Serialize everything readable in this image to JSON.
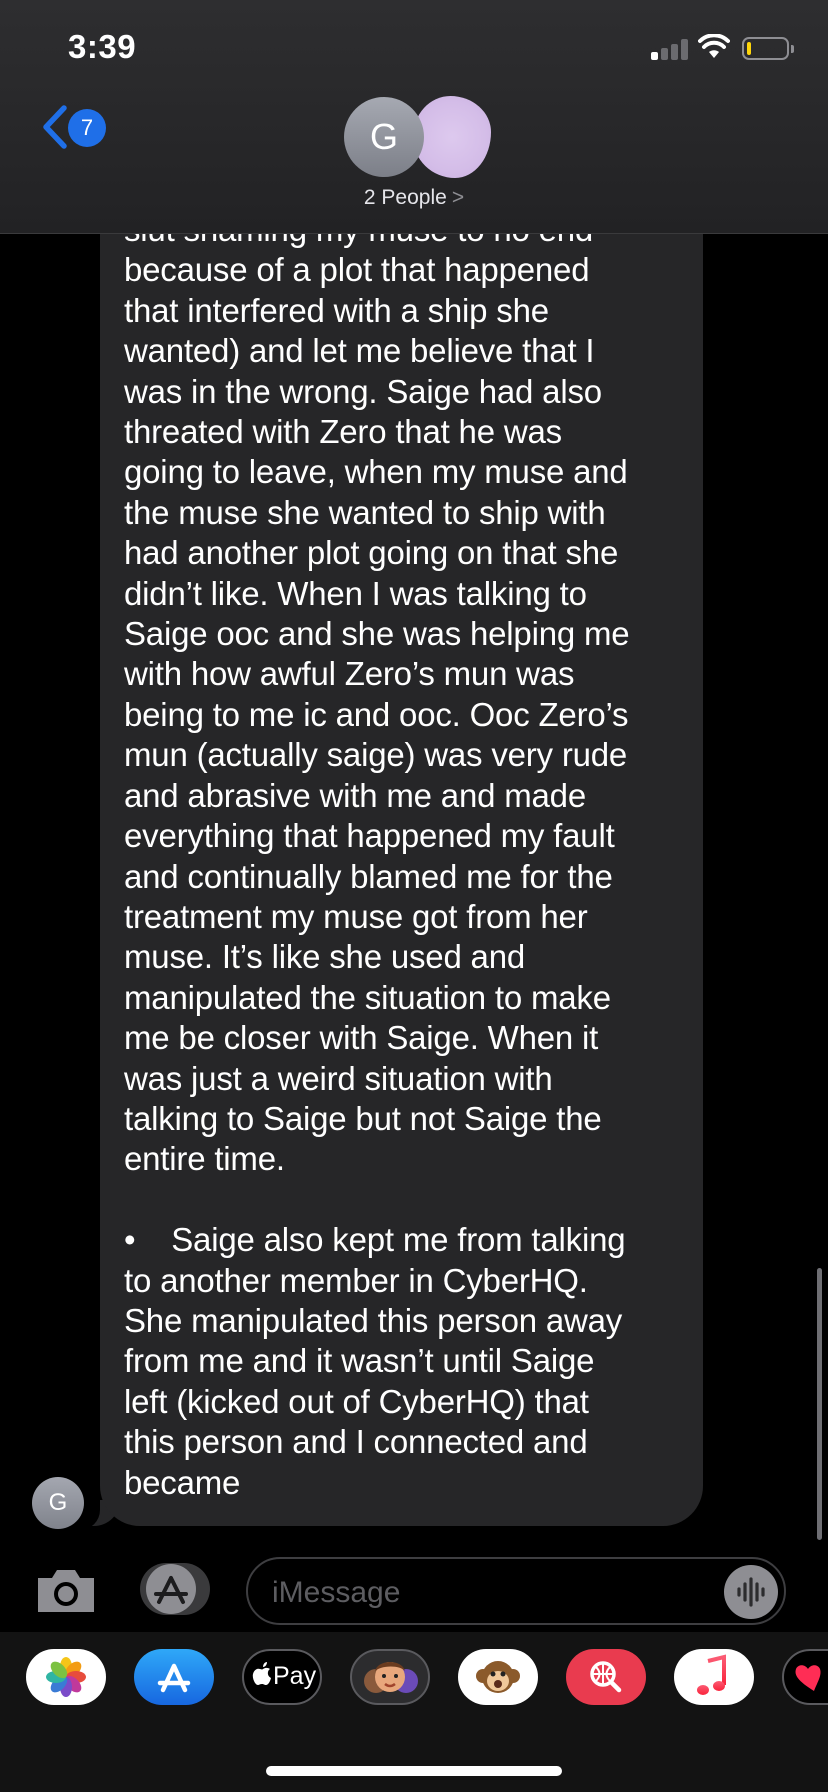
{
  "status_bar": {
    "time": "3:39"
  },
  "header": {
    "back_badge_count": "7",
    "avatar_initial": "G",
    "participants_label": "2 People",
    "participants_chevron": ">"
  },
  "message": {
    "sender_initial": "G",
    "text": "slut shaming my muse to no end\nbecause of a plot that happened\nthat interfered with a ship she\nwanted) and let me believe that I\nwas in the wrong. Saige had also\nthreated with Zero that he was\ngoing to leave, when my muse and\nthe muse she wanted to ship with\nhad another plot going on that she\ndidn’t like. When I was talking to\nSaige ooc and she was helping me\nwith how awful Zero’s mun was\nbeing to me ic and ooc. Ooc Zero’s\nmun (actually saige) was very rude\nand abrasive with me and made\neverything that happened my fault\nand continually blamed me for the\ntreatment my muse got from her\nmuse. It’s like she used and\nmanipulated the situation to make\nme be closer with Saige. When it\nwas just a weird situation with\ntalking to Saige but not Saige the\nentire time.\n\n•    Saige also kept me from talking\nto another member in CyberHQ.\nShe manipulated this person away\nfrom me and it wasn’t until Saige\nleft (kicked out of CyberHQ) that\nthis person and I connected and\nbecame"
  },
  "composer": {
    "placeholder": "iMessage"
  },
  "app_drawer": {
    "apple_pay_label": "Pay",
    "apps": [
      "photos-icon",
      "app-store-icon",
      "apple-pay-icon",
      "memoji-icon",
      "animoji-icon",
      "web-images-search-icon",
      "music-icon",
      "digital-touch-icon"
    ]
  },
  "colors": {
    "accent": "#1f6fe8",
    "bubble": "#262628",
    "header": "#2a2a2c",
    "background": "#000000",
    "battery_low": "#ffd60a"
  }
}
